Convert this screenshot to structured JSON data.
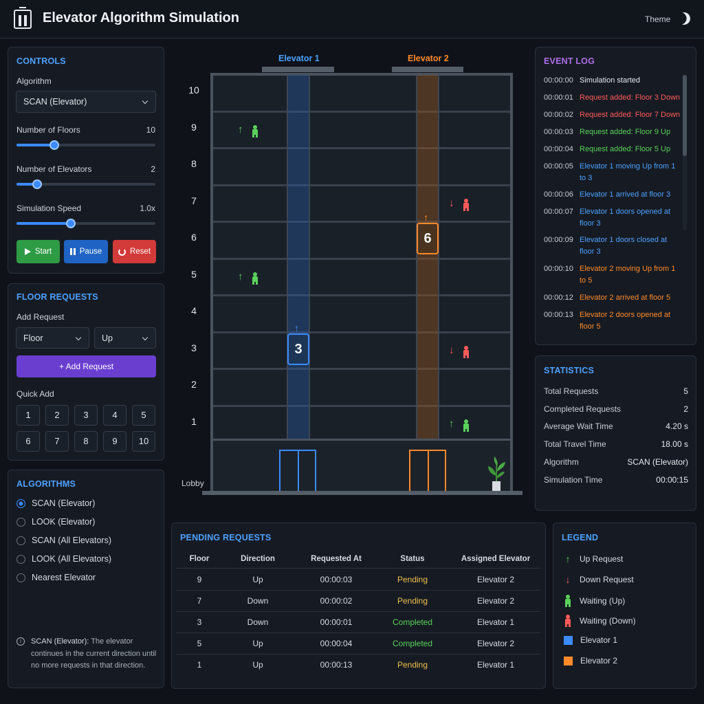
{
  "header": {
    "title": "Elevator Algorithm Simulation",
    "theme_label": "Theme"
  },
  "controls": {
    "title": "CONTROLS",
    "algorithm_label": "Algorithm",
    "algorithm_value": "SCAN (Elevator)",
    "floors_label": "Number of Floors",
    "floors_value": "10",
    "floors_level": 0.27,
    "elevators_label": "Number of Elevators",
    "elevators_value": "2",
    "elevators_level": 0.15,
    "speed_label": "Simulation Speed",
    "speed_value": "1.0x",
    "speed_level": 0.39,
    "start_label": "Start",
    "pause_label": "Pause",
    "reset_label": "Reset"
  },
  "floor_requests": {
    "title": "FLOOR REQUESTS",
    "add_label": "Add Request",
    "floor_select": "Floor",
    "direction_select": "Up",
    "add_button": "+ Add Request",
    "quick_add_label": "Quick Add",
    "quick": [
      "1",
      "2",
      "3",
      "4",
      "5",
      "6",
      "7",
      "8",
      "9",
      "10"
    ]
  },
  "algorithms": {
    "title": "ALGORITHMS",
    "options": [
      "SCAN (Elevator)",
      "LOOK (Elevator)",
      "SCAN (All Elevators)",
      "LOOK (All Elevators)",
      "Nearest Elevator"
    ],
    "selected": 0,
    "desc_name": "SCAN (Elevator):",
    "desc_text": " The elevator continues in the current direction until no more requests in that direction."
  },
  "building": {
    "elevator1_label": "Elevator 1",
    "elevator2_label": "Elevator 2",
    "floors": [
      "10",
      "9",
      "8",
      "7",
      "6",
      "5",
      "4",
      "3",
      "2",
      "1"
    ],
    "lobby_label": "Lobby",
    "car1_floor": "3",
    "car2_floor": "6",
    "car1_arrow": "↑",
    "car2_arrow": "↑",
    "waiting": [
      {
        "floor": 9,
        "dir": "up"
      },
      {
        "floor": 7,
        "dir": "down"
      },
      {
        "floor": 5,
        "dir": "up"
      },
      {
        "floor": 3,
        "dir": "down"
      },
      {
        "floor": 1,
        "dir": "up"
      }
    ]
  },
  "event_log": {
    "title": "EVENT LOG",
    "entries": [
      {
        "time": "00:00:00",
        "msg": "Simulation started",
        "color": "#e4e7ec"
      },
      {
        "time": "00:00:01",
        "msg": "Request added: Floor 3 Down",
        "color": "#ff5a5a"
      },
      {
        "time": "00:00:02",
        "msg": "Request added: Floor 7 Down",
        "color": "#ff5a5a"
      },
      {
        "time": "00:00:03",
        "msg": "Request added: Floor 9 Up",
        "color": "#5ad25a"
      },
      {
        "time": "00:00:04",
        "msg": "Request added: Floor 5 Up",
        "color": "#5ad25a"
      },
      {
        "time": "00:00:05",
        "msg": "Elevator 1 moving Up from 1 to 3",
        "color": "#4ea1ff"
      },
      {
        "time": "00:00:06",
        "msg": "Elevator 1 arrived at floor 3",
        "color": "#4ea1ff"
      },
      {
        "time": "00:00:07",
        "msg": "Elevator 1 doors opened at floor 3",
        "color": "#4ea1ff"
      },
      {
        "time": "00:00:09",
        "msg": "Elevator 1 doors closed at floor 3",
        "color": "#4ea1ff"
      },
      {
        "time": "00:00:10",
        "msg": "Elevator 2 moving Up from 1 to 5",
        "color": "#ff8a2a"
      },
      {
        "time": "00:00:12",
        "msg": "Elevator 2 arrived at floor 5",
        "color": "#ff8a2a"
      },
      {
        "time": "00:00:13",
        "msg": "Elevator 2 doors opened at floor 5",
        "color": "#ff8a2a"
      }
    ]
  },
  "statistics": {
    "title": "STATISTICS",
    "rows": [
      {
        "k": "Total Requests",
        "v": "5"
      },
      {
        "k": "Completed Requests",
        "v": "2"
      },
      {
        "k": "Average Wait Time",
        "v": "4.20 s"
      },
      {
        "k": "Total Travel Time",
        "v": "18.00 s"
      },
      {
        "k": "Algorithm",
        "v": "SCAN (Elevator)"
      },
      {
        "k": "Simulation Time",
        "v": "00:00:15"
      }
    ]
  },
  "pending": {
    "title": "PENDING REQUESTS",
    "columns": [
      "Floor",
      "Direction",
      "Requested At",
      "Status",
      "Assigned Elevator"
    ],
    "rows": [
      {
        "floor": "9",
        "direction": "Up",
        "at": "00:00:03",
        "status": "Pending",
        "elevator": "Elevator 2"
      },
      {
        "floor": "7",
        "direction": "Down",
        "at": "00:00:02",
        "status": "Pending",
        "elevator": "Elevator 2"
      },
      {
        "floor": "3",
        "direction": "Down",
        "at": "00:00:01",
        "status": "Completed",
        "elevator": "Elevator 1"
      },
      {
        "floor": "5",
        "direction": "Up",
        "at": "00:00:04",
        "status": "Completed",
        "elevator": "Elevator 2"
      },
      {
        "floor": "1",
        "direction": "Up",
        "at": "00:00:13",
        "status": "Pending",
        "elevator": "Elevator 1"
      }
    ]
  },
  "legend": {
    "title": "LEGEND",
    "items": [
      "Up Request",
      "Down Request",
      "Waiting (Up)",
      "Waiting (Down)",
      "Elevator 1",
      "Elevator 2"
    ]
  },
  "colors": {
    "accent": "#4ea1ff",
    "up": "#5ad25a",
    "down": "#ff5a5a",
    "elevator1": "#3c8cff",
    "elevator2": "#ff8a2a",
    "pending": "#f2c14e",
    "completed": "#5ad25a"
  }
}
